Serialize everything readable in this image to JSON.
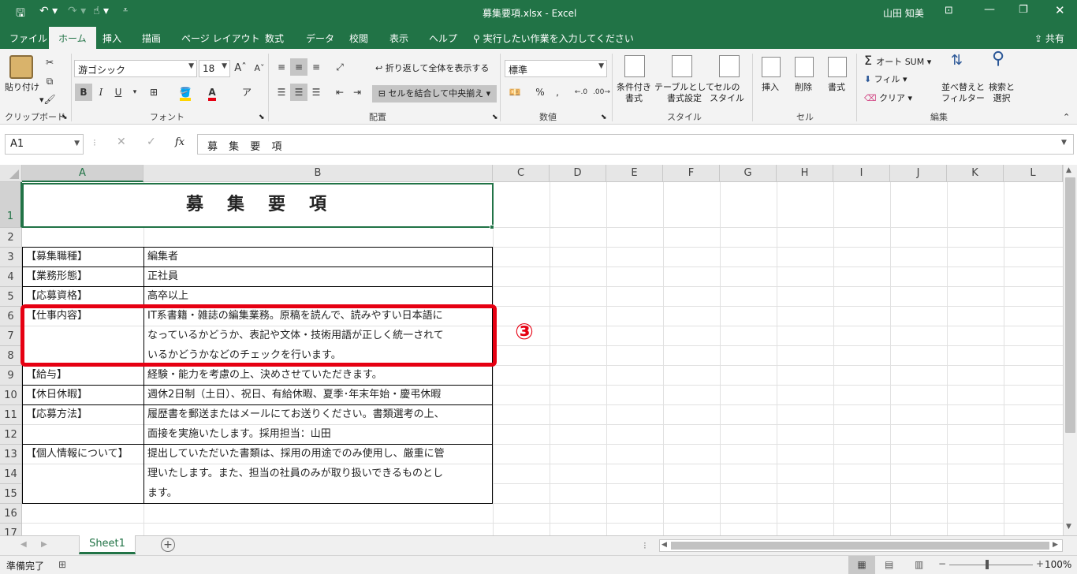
{
  "titlebar": {
    "document_title": "募集要項.xlsx  -  Excel",
    "user_name": "山田 知美",
    "save_icon": "save-icon",
    "undo_icon": "undo-icon",
    "redo_icon": "redo-icon",
    "touch_icon": "touch-mode-icon",
    "customize_icon": "customize-qat-icon",
    "ribbon_display_icon": "ribbon-display-options-icon",
    "minimize_icon": "minimize-icon",
    "restore_icon": "restore-icon",
    "close_icon": "close-icon"
  },
  "tabs": [
    "ファイル",
    "ホーム",
    "挿入",
    "描画",
    "ページ レイアウト",
    "数式",
    "データ",
    "校閲",
    "表示",
    "ヘルプ"
  ],
  "active_tab": "ホーム",
  "tell_me": "実行したい作業を入力してください",
  "share_label": "共有",
  "ribbon": {
    "clipboard": {
      "label": "クリップボード",
      "paste": "貼り付け"
    },
    "font": {
      "label": "フォント",
      "font_name": "游ゴシック",
      "font_size": "18",
      "bold": "B",
      "italic": "I",
      "underline": "U",
      "font_color": "A"
    },
    "alignment": {
      "label": "配置",
      "wrap_text": "折り返して全体を表示する",
      "merge_center": "セルを結合して中央揃え"
    },
    "number": {
      "label": "数値",
      "format": "標準",
      "percent": "%",
      "comma": ","
    },
    "styles": {
      "label": "スタイル",
      "conditional_1": "条件付き",
      "conditional_2": "書式",
      "format_table_1": "テーブルとして",
      "format_table_2": "書式設定",
      "cell_styles_1": "セルの",
      "cell_styles_2": "スタイル"
    },
    "cells": {
      "label": "セル",
      "insert": "挿入",
      "delete": "削除",
      "format": "書式"
    },
    "editing": {
      "label": "編集",
      "autosum": "オート SUM",
      "fill": "フィル",
      "clear": "クリア",
      "sort_1": "並べ替えと",
      "sort_2": "フィルター",
      "find_1": "検索と",
      "find_2": "選択"
    }
  },
  "formula_bar": {
    "name_box": "A1",
    "fx": "fx",
    "formula": "募 集 要 項"
  },
  "columns": [
    "A",
    "B",
    "C",
    "D",
    "E",
    "F",
    "G",
    "H",
    "I",
    "J",
    "K",
    "L"
  ],
  "rows": [
    "1",
    "2",
    "3",
    "4",
    "5",
    "6",
    "7",
    "8",
    "9",
    "10",
    "11",
    "12",
    "13",
    "14",
    "15",
    "16",
    "17"
  ],
  "sheet": {
    "title": "募　集　要　項",
    "entries": [
      {
        "label": "【募集職種】",
        "lines": [
          "編集者"
        ]
      },
      {
        "label": "【業務形態】",
        "lines": [
          "正社員"
        ]
      },
      {
        "label": "【応募資格】",
        "lines": [
          "高卒以上"
        ]
      },
      {
        "label": "【仕事内容】",
        "lines": [
          "IT系書籍・雑誌の編集業務。原稿を読んで、読みやすい日本語に",
          "なっているかどうか、表記や文体・技術用語が正しく統一されて",
          "いるかどうかなどのチェックを行います。"
        ]
      },
      {
        "label": "【給与】",
        "lines": [
          "経験・能力を考慮の上、決めさせていただきます。"
        ]
      },
      {
        "label": "【休日休暇】",
        "lines": [
          "週休2日制（土日）、祝日、有給休暇、夏季･年末年始・慶弔休暇"
        ]
      },
      {
        "label": "【応募方法】",
        "lines": [
          "履歴書を郵送またはメールにてお送りください。書類選考の上、",
          "面接を実施いたします。採用担当：山田"
        ]
      },
      {
        "label": "【個人情報について】",
        "lines": [
          "提出していただいた書類は、採用の用途でのみ使用し、厳重に管",
          "理いたします。また、担当の社員のみが取り扱いできるものとし",
          "ます。"
        ]
      }
    ]
  },
  "callout": {
    "number": "③",
    "color": "#e60012"
  },
  "sheet_tab": "Sheet1",
  "status": {
    "ready": "準備完了",
    "zoom": "100%"
  },
  "colors": {
    "excel_green": "#217346",
    "highlight_red": "#e60012"
  }
}
